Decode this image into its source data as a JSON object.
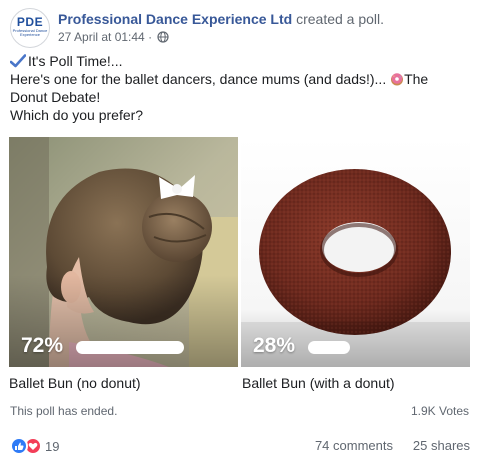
{
  "post": {
    "author": "Professional Dance Experience Ltd",
    "action": "created a poll.",
    "timestamp": "27 April at 01:44",
    "separator": " · ",
    "avatar_logo": "PDE",
    "avatar_logo_sub": "Professional Dance Experience",
    "text_line1": "It's Poll Time!...",
    "text_line2": "Here's one for the ballet dancers, dance mums (and dads!)...",
    "text_line2_suffix": "The",
    "text_line3": "Donut Debate!",
    "text_line4": "Which do you prefer?"
  },
  "poll": {
    "options": [
      {
        "label": "Ballet Bun (no donut)",
        "percent_text": "72%",
        "percent": 72
      },
      {
        "label": "Ballet Bun (with a donut)",
        "percent_text": "28%",
        "percent": 28
      }
    ],
    "status": "This poll has ended.",
    "votes": "1.9K Votes"
  },
  "engagement": {
    "reactions_count": "19",
    "comments": "74 comments",
    "shares": "25 shares"
  },
  "colors": {
    "author_link": "#385898",
    "secondary_text": "#606770",
    "like_blue": "#2f7bf6",
    "love_red": "#f33e58"
  },
  "icons": {
    "check": "check-icon",
    "donut": "donut-icon",
    "globe": "globe-icon",
    "like": "like-icon",
    "love": "love-icon"
  }
}
